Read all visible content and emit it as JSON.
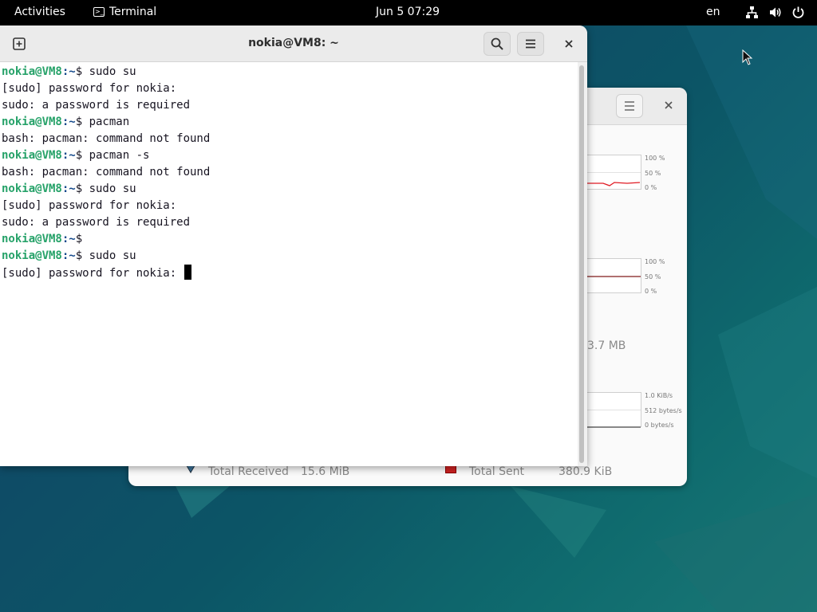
{
  "topbar": {
    "activities": "Activities",
    "app_name": "Terminal",
    "clock": "Jun 5  07:29",
    "language": "en",
    "tray_icons": [
      "network-icon",
      "volume-icon",
      "power-icon"
    ]
  },
  "terminal": {
    "title": "nokia@VM8: ~",
    "lines": [
      {
        "user": "nokia@VM8",
        "path": ":~",
        "cmd": "$ sudo su"
      },
      {
        "text": "[sudo] password for nokia:"
      },
      {
        "text": "sudo: a password is required"
      },
      {
        "user": "nokia@VM8",
        "path": ":~",
        "cmd": "$ pacman"
      },
      {
        "text": "bash: pacman: command not found"
      },
      {
        "user": "nokia@VM8",
        "path": ":~",
        "cmd": "$ pacman -s"
      },
      {
        "text": "bash: pacman: command not found"
      },
      {
        "user": "nokia@VM8",
        "path": ":~",
        "cmd": "$ sudo su"
      },
      {
        "text": "[sudo] password for nokia:"
      },
      {
        "text": "sudo: a password is required"
      },
      {
        "user": "nokia@VM8",
        "path": ":~",
        "cmd": "$"
      },
      {
        "user": "nokia@VM8",
        "path": ":~",
        "cmd": "$ sudo su"
      },
      {
        "text": "[sudo] password for nokia: "
      }
    ]
  },
  "system_monitor": {
    "cpu_ticks": [
      "100 %",
      "50 %",
      "0 %"
    ],
    "memory_ticks": [
      "100 %",
      "50 %",
      "0 %"
    ],
    "memory_partial_value": "3.7 MB",
    "network_ticks": [
      "1.0 KiB/s",
      "512 bytes/s",
      "0 bytes/s"
    ],
    "total_received_label": "Total Received",
    "total_received_value": "15.6 MiB",
    "total_sent_label": "Total Sent",
    "total_sent_value": "380.9 KiB"
  },
  "colors": {
    "prompt_user": "#26a269",
    "prompt_path": "#12488b",
    "sent_color": "#cc2222",
    "cpu_line": "#e01b24"
  }
}
